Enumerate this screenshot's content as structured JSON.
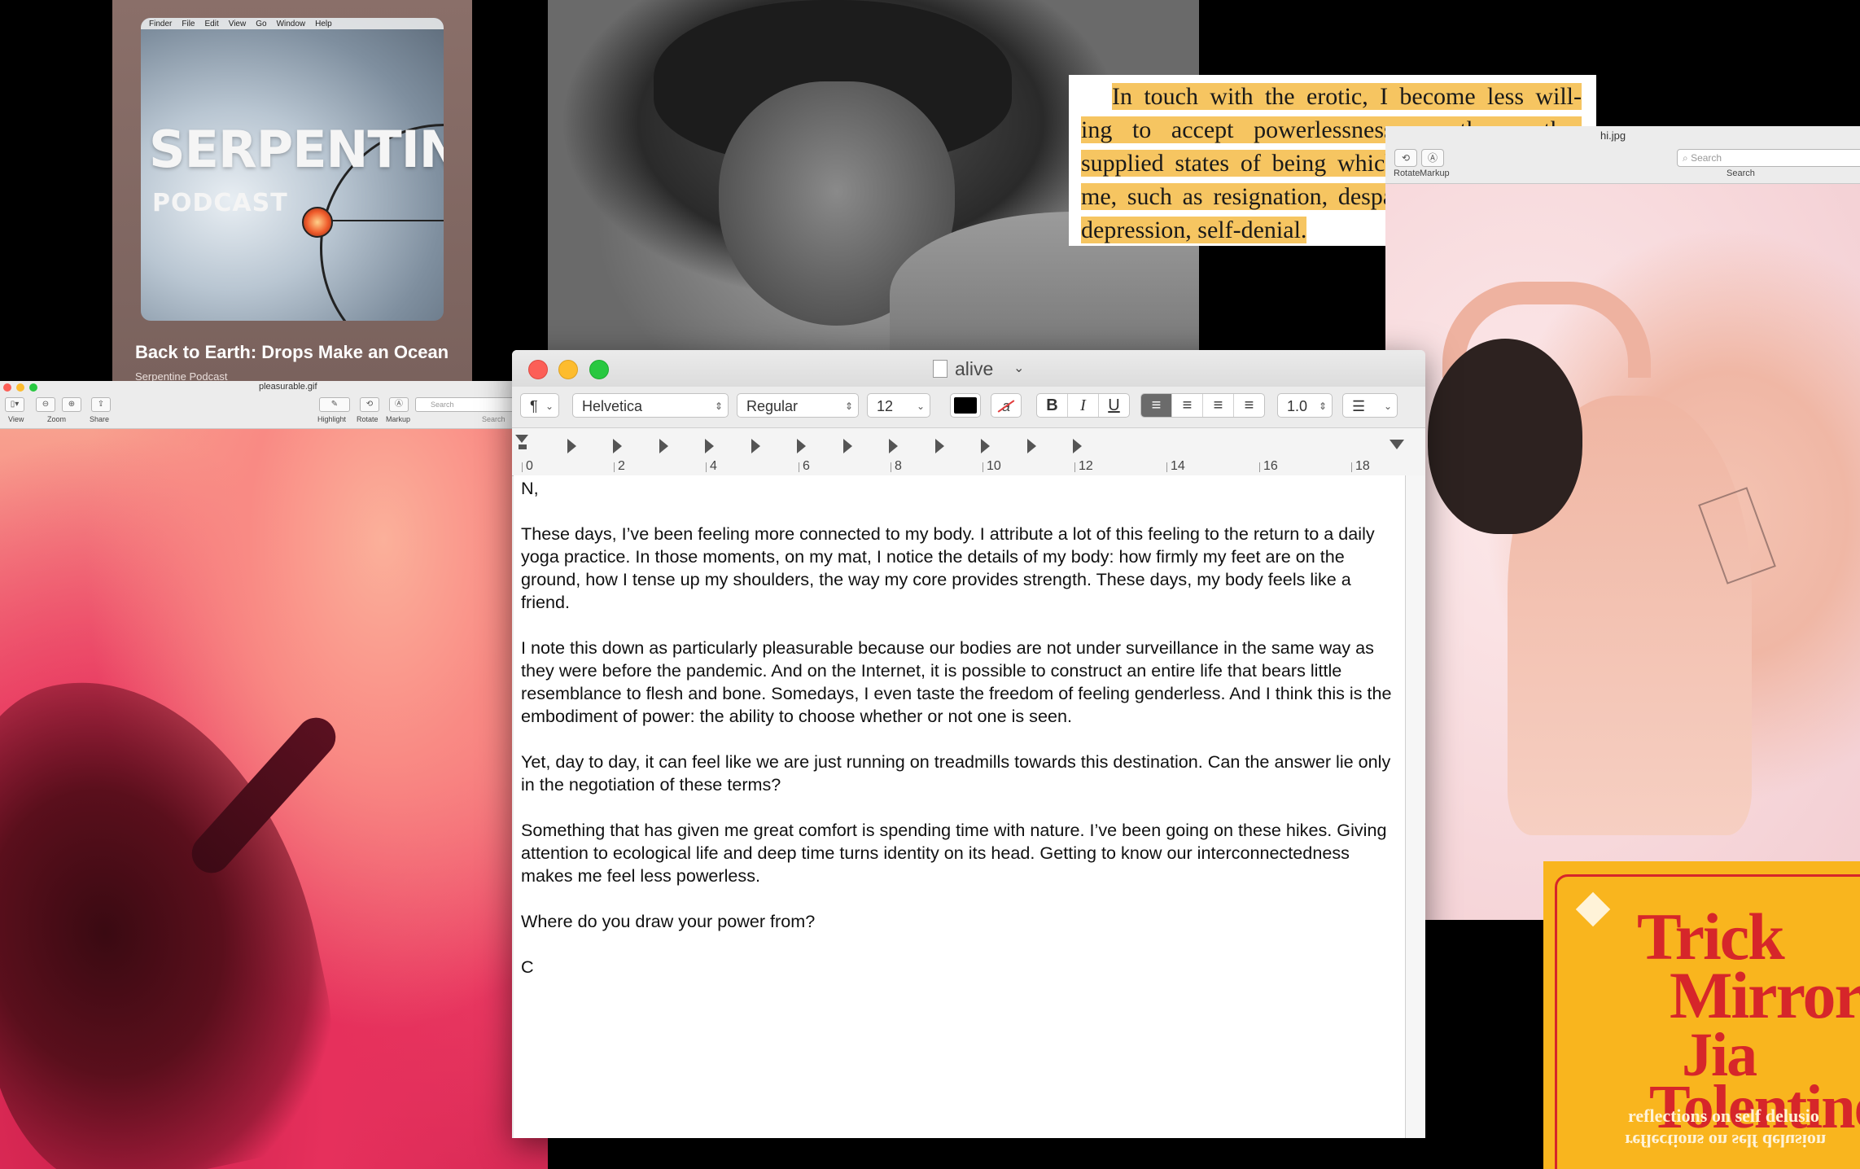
{
  "podcast": {
    "menubar": [
      "Finder",
      "File",
      "Edit",
      "View",
      "Go",
      "Window",
      "Help"
    ],
    "wordmark": "SERPENTINE",
    "wordmark_sub": "PODCAST",
    "title": "Back to Earth: Drops Make an Ocean",
    "subtitle": "Serpentine Podcast"
  },
  "quote": {
    "lines": [
      "In touch with the erotic, I become less will-",
      "ing to accept powerlessness, or those other",
      "supplied states of being which are not native to",
      "me, such as resignation, despair, self-effacement,",
      "depression, self-denial."
    ],
    "highlight_color": "#f6c561"
  },
  "hi_window": {
    "filename": "hi.jpg",
    "tools": [
      {
        "icon": "rotate-icon",
        "glyph": "⟲",
        "label": "Rotate"
      },
      {
        "icon": "markup-icon",
        "glyph": "Ⓐ",
        "label": "Markup"
      }
    ],
    "search_placeholder": "Search",
    "search_label": "Search"
  },
  "book": {
    "title_line1": "Trick",
    "title_line2": "Mirror",
    "author_line1": "Jia",
    "author_line2": "Tolentino",
    "subtitle": "reflections on self delusio",
    "subtitle_mirror": "reflections on self delusion"
  },
  "gif_window": {
    "filename": "pleasurable.gif",
    "tools_left": [
      {
        "icon": "sidebar-icon",
        "glyph": "▯▾",
        "label": "View"
      },
      {
        "icon": "zoom-out-icon",
        "glyph": "⊖",
        "label": "Zoom"
      },
      {
        "icon": "zoom-in-icon",
        "glyph": "⊕",
        "label": ""
      },
      {
        "icon": "share-icon",
        "glyph": "⇪",
        "label": "Share"
      }
    ],
    "tools_right": [
      {
        "icon": "highlight-icon",
        "glyph": "✎",
        "label": "Highlight"
      },
      {
        "icon": "rotate-icon",
        "glyph": "⟲",
        "label": "Rotate"
      },
      {
        "icon": "markup-icon",
        "glyph": "Ⓐ",
        "label": "Markup"
      }
    ],
    "search_placeholder": "Search",
    "search_label": "Search"
  },
  "textedit": {
    "title": "alive",
    "toolbar": {
      "paragraph": "¶",
      "font_family": "Helvetica",
      "font_style": "Regular",
      "font_size": "12",
      "text_color": "#000000",
      "bold": "B",
      "italic": "I",
      "underline": "U",
      "highlight": "a",
      "align_options": [
        "≡",
        "≡",
        "≡",
        "≡"
      ],
      "align_selected": 0,
      "line_spacing": "1.0",
      "list": "☰"
    },
    "ruler": {
      "labels": [
        "0",
        "2",
        "4",
        "6",
        "8",
        "10",
        "12",
        "14",
        "16",
        "18"
      ]
    },
    "paragraphs": [
      "N,",
      "These days, I’ve been feeling more connected to my body. I attribute a lot of this feeling to the return to a daily yoga practice. In those moments, on my mat, I notice the details of my body: how firmly my feet are on the ground, how I tense up my shoulders, the way my core provides strength. These days, my body feels like a friend.",
      "I note this down as particularly pleasurable because our bodies are not under surveillance in the same way as they were before the pandemic. And on the Internet, it is possible to construct an entire life that bears little resemblance to flesh and bone. Somedays, I even taste the freedom of feeling genderless. And I think this is the embodiment of power: the ability to choose whether or not one is seen.",
      "Yet, day to day, it can feel like we are just running on treadmills towards this destination. Can the answer lie only in the negotiation of these terms?",
      "Something that has given me great comfort is spending time with nature. I’ve been going on these hikes. Giving attention to ecological life and deep time turns identity on its head. Getting to know our interconnectedness makes me feel less powerless.",
      "Where do you draw your power from?",
      "C"
    ]
  }
}
